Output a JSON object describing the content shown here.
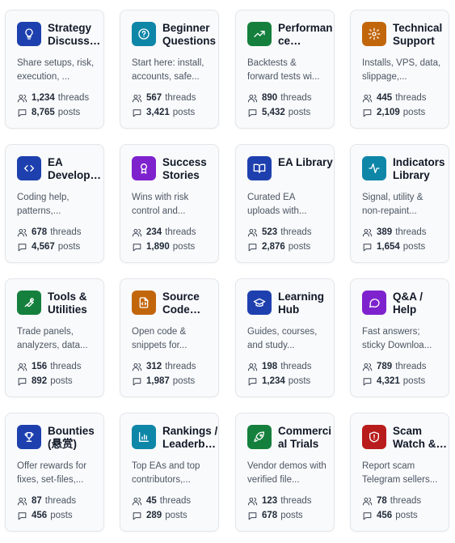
{
  "threads_label": "threads",
  "posts_label": "posts",
  "categories": [
    {
      "title": "Strategy Discussion",
      "desc": "Share setups, risk, execution, ...",
      "threads": "1,234",
      "posts": "8,765",
      "icon": "bulb-icon",
      "color": "#1e40af"
    },
    {
      "title": "Beginner Questions",
      "desc": "Start here: install, accounts, safe...",
      "threads": "567",
      "posts": "3,421",
      "icon": "help-circle-icon",
      "color": "#0e86a8"
    },
    {
      "title": "Performance Reports",
      "desc": "Backtests & forward tests wi...",
      "threads": "890",
      "posts": "5,432",
      "icon": "trend-up-icon",
      "color": "#15803d"
    },
    {
      "title": "Technical Support",
      "desc": "Installs, VPS, data, slippage,...",
      "threads": "445",
      "posts": "2,109",
      "icon": "gear-icon",
      "color": "#c2660c"
    },
    {
      "title": "EA Development",
      "desc": "Coding help, patterns,...",
      "threads": "678",
      "posts": "4,567",
      "icon": "code-icon",
      "color": "#1e40af"
    },
    {
      "title": "Success Stories",
      "desc": "Wins with risk control and...",
      "threads": "234",
      "posts": "1,890",
      "icon": "award-icon",
      "color": "#7e22ce"
    },
    {
      "title": "EA Library",
      "desc": "Curated EA uploads with...",
      "threads": "523",
      "posts": "2,876",
      "icon": "book-icon",
      "color": "#1e40af"
    },
    {
      "title": "Indicators Library",
      "desc": "Signal, utility & non-repaint...",
      "threads": "389",
      "posts": "1,654",
      "icon": "pulse-icon",
      "color": "#0e86a8"
    },
    {
      "title": "Tools & Utilities",
      "desc": "Trade panels, analyzers, data...",
      "threads": "156",
      "posts": "892",
      "icon": "wrench-icon",
      "color": "#15803d"
    },
    {
      "title": "Source Code Sharing",
      "desc": "Open code & snippets for...",
      "threads": "312",
      "posts": "1,987",
      "icon": "file-code-icon",
      "color": "#c2660c"
    },
    {
      "title": "Learning Hub",
      "desc": "Guides, courses, and study...",
      "threads": "198",
      "posts": "1,234",
      "icon": "graduation-cap-icon",
      "color": "#1e40af"
    },
    {
      "title": "Q&A / Help",
      "desc": "Fast answers; sticky Downloa...",
      "threads": "789",
      "posts": "4,321",
      "icon": "chat-bubble-icon",
      "color": "#7e22ce"
    },
    {
      "title": "Bounties (悬赏)",
      "desc": "Offer rewards for fixes, set-files,...",
      "threads": "87",
      "posts": "456",
      "icon": "trophy-icon",
      "color": "#1e40af"
    },
    {
      "title": "Rankings / Leaderboards",
      "desc": "Top EAs and top contributors,...",
      "threads": "45",
      "posts": "289",
      "icon": "bar-chart-icon",
      "color": "#0e86a8"
    },
    {
      "title": "Commercial Trials",
      "desc": "Vendor demos with verified file...",
      "threads": "123",
      "posts": "678",
      "icon": "rocket-icon",
      "color": "#15803d"
    },
    {
      "title": "Scam Watch & Alerts",
      "desc": "Report scam Telegram sellers...",
      "threads": "78",
      "posts": "456",
      "icon": "shield-alert-icon",
      "color": "#b91c1c"
    }
  ]
}
